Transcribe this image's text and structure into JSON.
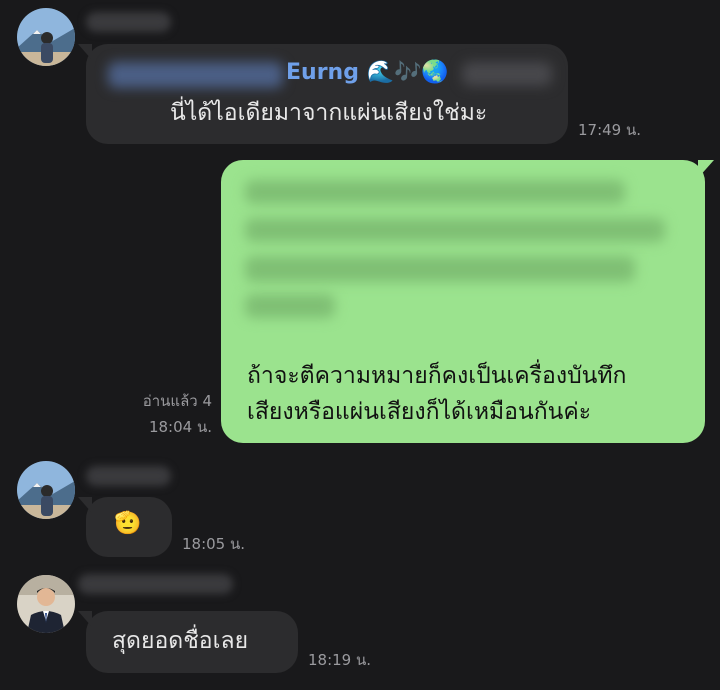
{
  "messages": [
    {
      "reply_preview": "Eurng 🌊🎶🌏",
      "text": "นี่ได้ไอเดียมาจากแผ่นเสียงใช่มะ",
      "time": "17:49 น."
    },
    {
      "outgoing": true,
      "text_line1": "ถ้าจะตีความหมายก็คงเป็นเครื่องบันทึก",
      "text_line2": "เสียงหรือแผ่นเสียงก็ได้เหมือนกันค่ะ",
      "read_status": "อ่านแล้ว 4",
      "time": "18:04 น."
    },
    {
      "emoji": "🫡",
      "time": "18:05 น."
    },
    {
      "text": "สุดยอดชื่อเลย",
      "time": "18:19 น."
    }
  ],
  "colors": {
    "background": "#19191b",
    "incoming_bubble": "#2c2c2e",
    "outgoing_bubble": "#9be38e",
    "reply_name": "#6fa0ea",
    "timestamp": "#9a9a9e"
  },
  "icons": {
    "avatar_1": "avatar-mountain-photo",
    "avatar_2": "avatar-mountain-photo",
    "avatar_3": "avatar-man-suit-photo"
  }
}
